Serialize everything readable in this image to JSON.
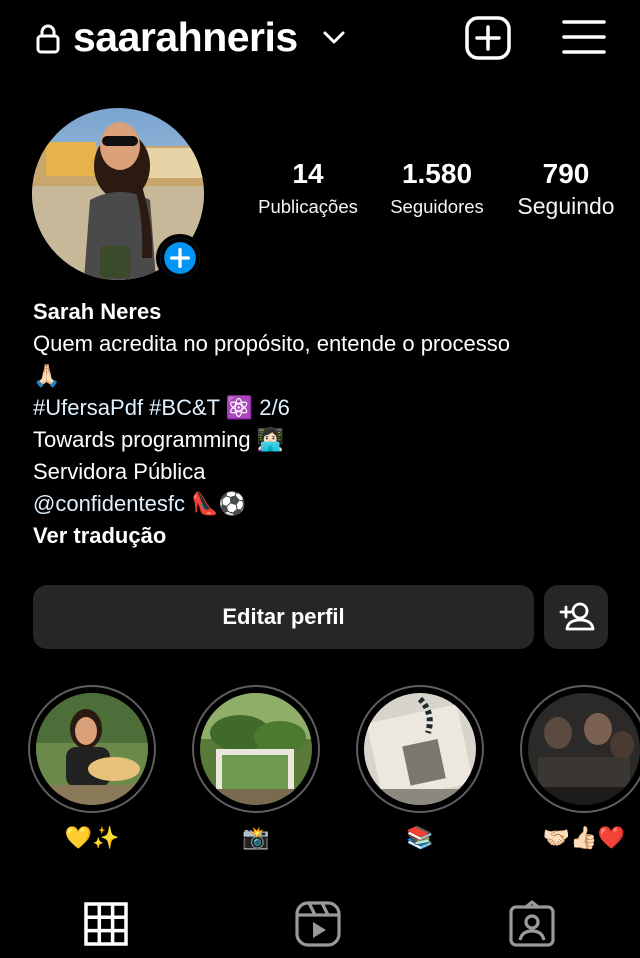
{
  "header": {
    "username": "saarahneris",
    "icons": [
      "lock-icon",
      "chevron-down-icon",
      "new-post-icon",
      "hamburger-menu-icon"
    ]
  },
  "profile": {
    "stats": [
      {
        "value": "14",
        "label": "Publicações"
      },
      {
        "value": "1.580",
        "label": "Seguidores"
      },
      {
        "value": "790",
        "label": "Seguindo"
      }
    ],
    "name": "Sarah Neres",
    "bio_lines": [
      "Quem acredita no propósito, entende o processo",
      "🙏🏻",
      "#UfersaPdf #BC&T ⚛️ 2/6",
      "Towards programming 👩🏻‍💻",
      "Servidora Pública",
      "@confidentesfc 👠⚽"
    ],
    "translate": "Ver tradução"
  },
  "actions": {
    "edit_profile": "Editar perfil"
  },
  "highlights": [
    {
      "label": "💛✨"
    },
    {
      "label": "📸"
    },
    {
      "label": "📚"
    },
    {
      "label": "🤝🏻👍🏻❤️"
    }
  ],
  "tabs": [
    "grid-icon",
    "reels-icon",
    "tagged-icon"
  ],
  "colors": {
    "background": "#000000",
    "button": "#262626",
    "accent": "#0095f6"
  }
}
